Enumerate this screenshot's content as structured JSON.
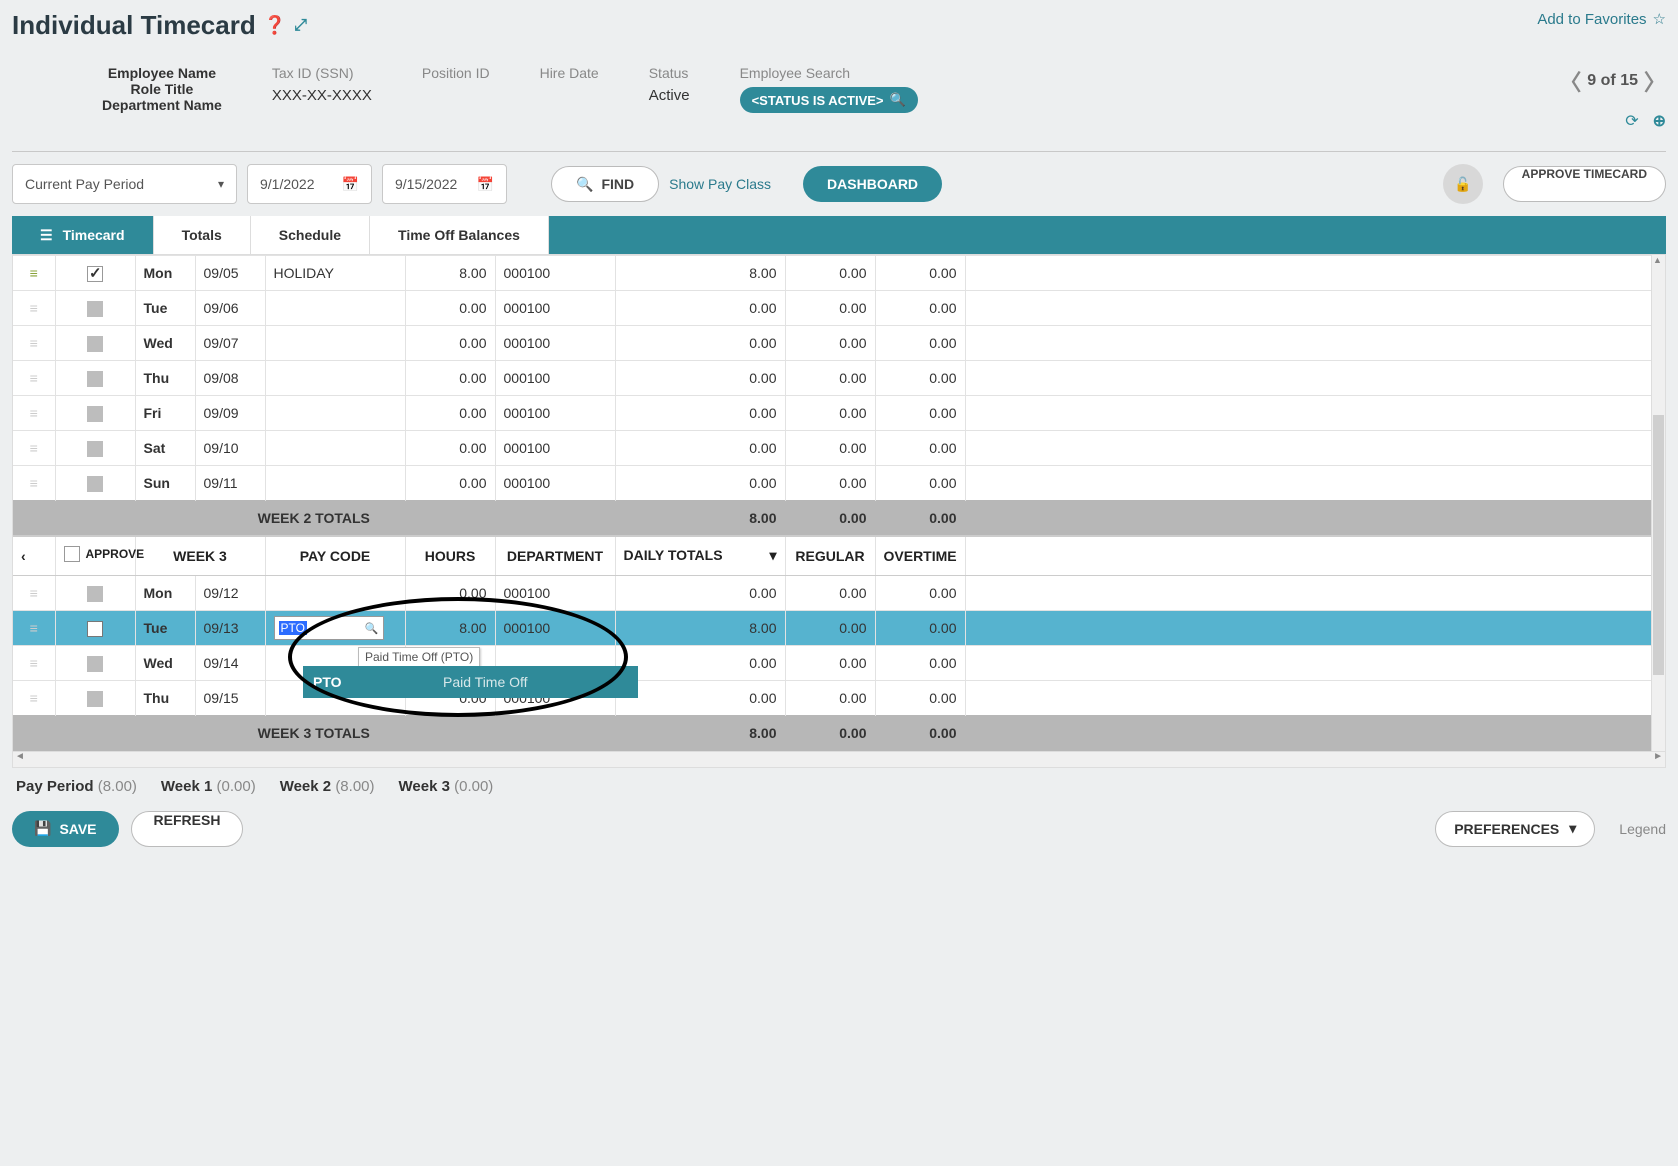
{
  "page": {
    "title": "Individual Timecard",
    "favorites": "Add to Favorites"
  },
  "employee": {
    "name": "Employee Name",
    "role": "Role Title",
    "dept": "Department Name"
  },
  "header_fields": {
    "taxid_label": "Tax ID (SSN)",
    "taxid_value": "XXX-XX-XXXX",
    "position_label": "Position ID",
    "position_value": "",
    "hire_label": "Hire Date",
    "hire_value": "",
    "status_label": "Status",
    "status_value": "Active",
    "search_label": "Employee Search",
    "search_pill": "<STATUS IS ACTIVE>"
  },
  "pager": {
    "text": "9 of 15"
  },
  "toolbar": {
    "period_select": "Current Pay Period",
    "date_start": "9/1/2022",
    "date_end": "9/15/2022",
    "find": "FIND",
    "show_pay_class": "Show Pay Class",
    "dashboard": "DASHBOARD",
    "approve": "APPROVE TIMECARD"
  },
  "tabs": {
    "timecard": "Timecard",
    "totals": "Totals",
    "schedule": "Schedule",
    "balances": "Time Off Balances"
  },
  "columns": {
    "approve": "APPROVE",
    "week3": "WEEK 3",
    "paycode": "PAY CODE",
    "hours": "HOURS",
    "department": "DEPARTMENT",
    "daily_totals": "DAILY TOTALS",
    "regular": "REGULAR",
    "overtime": "OVERTIME"
  },
  "rows_week2": [
    {
      "day": "Mon",
      "date": "09/05",
      "checked": true,
      "paycode": "HOLIDAY",
      "hours": "8.00",
      "dept": "000100",
      "dt": "8.00",
      "reg": "0.00",
      "ot": "0.00"
    },
    {
      "day": "Tue",
      "date": "09/06",
      "hours": "0.00",
      "dept": "000100",
      "dt": "0.00",
      "reg": "0.00",
      "ot": "0.00"
    },
    {
      "day": "Wed",
      "date": "09/07",
      "hours": "0.00",
      "dept": "000100",
      "dt": "0.00",
      "reg": "0.00",
      "ot": "0.00"
    },
    {
      "day": "Thu",
      "date": "09/08",
      "hours": "0.00",
      "dept": "000100",
      "dt": "0.00",
      "reg": "0.00",
      "ot": "0.00"
    },
    {
      "day": "Fri",
      "date": "09/09",
      "hours": "0.00",
      "dept": "000100",
      "dt": "0.00",
      "reg": "0.00",
      "ot": "0.00"
    },
    {
      "day": "Sat",
      "date": "09/10",
      "hours": "0.00",
      "dept": "000100",
      "dt": "0.00",
      "reg": "0.00",
      "ot": "0.00"
    },
    {
      "day": "Sun",
      "date": "09/11",
      "hours": "0.00",
      "dept": "000100",
      "dt": "0.00",
      "reg": "0.00",
      "ot": "0.00"
    }
  ],
  "week2_totals": {
    "label": "WEEK 2 TOTALS",
    "dt": "8.00",
    "reg": "0.00",
    "ot": "0.00"
  },
  "rows_week3": [
    {
      "day": "Mon",
      "date": "09/12",
      "hours": "0.00",
      "dept": "000100",
      "dt": "0.00",
      "reg": "0.00",
      "ot": "0.00"
    },
    {
      "day": "Tue",
      "date": "09/13",
      "selected": true,
      "paycode_edit": "PTO",
      "hours": "8.00",
      "dept": "000100",
      "dt": "8.00",
      "reg": "0.00",
      "ot": "0.00"
    },
    {
      "day": "Wed",
      "date": "09/14",
      "dt": "0.00",
      "reg": "0.00",
      "ot": "0.00"
    },
    {
      "day": "Thu",
      "date": "09/15",
      "hours": "0.00",
      "dept": "000100",
      "dt": "0.00",
      "reg": "0.00",
      "ot": "0.00"
    }
  ],
  "week3_totals": {
    "label": "WEEK 3 TOTALS",
    "dt": "8.00",
    "reg": "0.00",
    "ot": "0.00"
  },
  "tooltip": "Paid Time Off (PTO)",
  "dropdown": {
    "code": "PTO",
    "desc": "Paid Time Off"
  },
  "summary": {
    "payperiod_label": "Pay Period",
    "payperiod_val": "(8.00)",
    "w1_label": "Week 1",
    "w1_val": "(0.00)",
    "w2_label": "Week 2",
    "w2_val": "(8.00)",
    "w3_label": "Week 3",
    "w3_val": "(0.00)"
  },
  "footer": {
    "save": "SAVE",
    "refresh": "REFRESH",
    "preferences": "PREFERENCES",
    "legend": "Legend"
  }
}
